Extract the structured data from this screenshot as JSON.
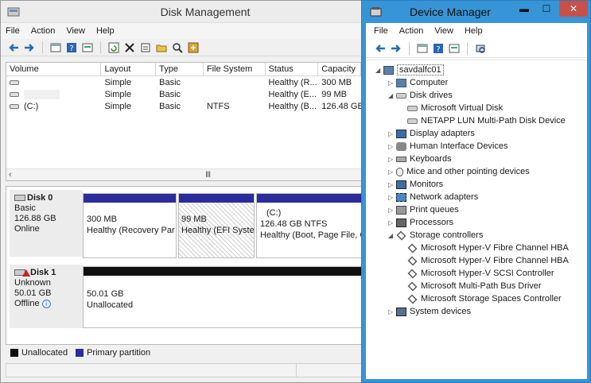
{
  "disk_management": {
    "title": "Disk Management",
    "menu": [
      "File",
      "Action",
      "View",
      "Help"
    ],
    "columns": [
      "Volume",
      "Layout",
      "Type",
      "File System",
      "Status",
      "Capacity"
    ],
    "volumes": [
      {
        "volume": "",
        "layout": "Simple",
        "type": "Basic",
        "fs": "",
        "status": "Healthy (R...",
        "capacity": "300 MB"
      },
      {
        "volume": "",
        "layout": "Simple",
        "type": "Basic",
        "fs": "",
        "status": "Healthy (E...",
        "capacity": "99 MB"
      },
      {
        "volume": "(C:)",
        "layout": "Simple",
        "type": "Basic",
        "fs": "NTFS",
        "status": "Healthy (B...",
        "capacity": "126.48 GB"
      }
    ],
    "scroll_grip": "III",
    "disks": [
      {
        "name": "Disk 0",
        "type": "Basic",
        "size": "126.88 GB",
        "state": "Online",
        "partitions": [
          {
            "label": "",
            "size": "300 MB",
            "status": "Healthy (Recovery Par"
          },
          {
            "label": "",
            "size": "99 MB",
            "status": "Healthy (EFI Syste"
          },
          {
            "label": "(C:)",
            "size": "126.48 GB NTFS",
            "status": "Healthy (Boot, Page File, C"
          }
        ]
      },
      {
        "name": "Disk 1",
        "type": "Unknown",
        "size": "50.01 GB",
        "state": "Offline",
        "partitions": [
          {
            "size": "50.01 GB",
            "status": "Unallocated"
          }
        ]
      }
    ],
    "legend": [
      {
        "label": "Unallocated",
        "color": "#101010"
      },
      {
        "label": "Primary partition",
        "color": "#2c2c9a"
      }
    ]
  },
  "device_manager": {
    "title": "Device Manager",
    "menu": [
      "File",
      "Action",
      "View",
      "Help"
    ],
    "window_controls": {
      "minimize": "▬",
      "maximize": "☐",
      "close": "✕"
    },
    "root": "savdalfc01",
    "tree": [
      {
        "label": "Computer",
        "icon": "computer-icon",
        "expanded": false
      },
      {
        "label": "Disk drives",
        "icon": "disk-drive-icon",
        "expanded": true,
        "children": [
          "Microsoft Virtual Disk",
          "NETAPP LUN  Multi-Path Disk Device"
        ]
      },
      {
        "label": "Display adapters",
        "icon": "display-adapter-icon",
        "expanded": false
      },
      {
        "label": "Human Interface Devices",
        "icon": "hid-icon",
        "expanded": false
      },
      {
        "label": "Keyboards",
        "icon": "keyboard-icon",
        "expanded": false
      },
      {
        "label": "Mice and other pointing devices",
        "icon": "mouse-icon",
        "expanded": false
      },
      {
        "label": "Monitors",
        "icon": "monitor-icon",
        "expanded": false
      },
      {
        "label": "Network adapters",
        "icon": "network-icon",
        "expanded": false
      },
      {
        "label": "Print queues",
        "icon": "printer-icon",
        "expanded": false
      },
      {
        "label": "Processors",
        "icon": "processor-icon",
        "expanded": false
      },
      {
        "label": "Storage controllers",
        "icon": "storage-controller-icon",
        "expanded": true,
        "children": [
          "Microsoft Hyper-V Fibre Channel HBA",
          "Microsoft Hyper-V Fibre Channel HBA",
          "Microsoft Hyper-V SCSI Controller",
          "Microsoft Multi-Path Bus Driver",
          "Microsoft Storage Spaces Controller"
        ]
      },
      {
        "label": "System devices",
        "icon": "system-devices-icon",
        "expanded": false
      }
    ]
  }
}
